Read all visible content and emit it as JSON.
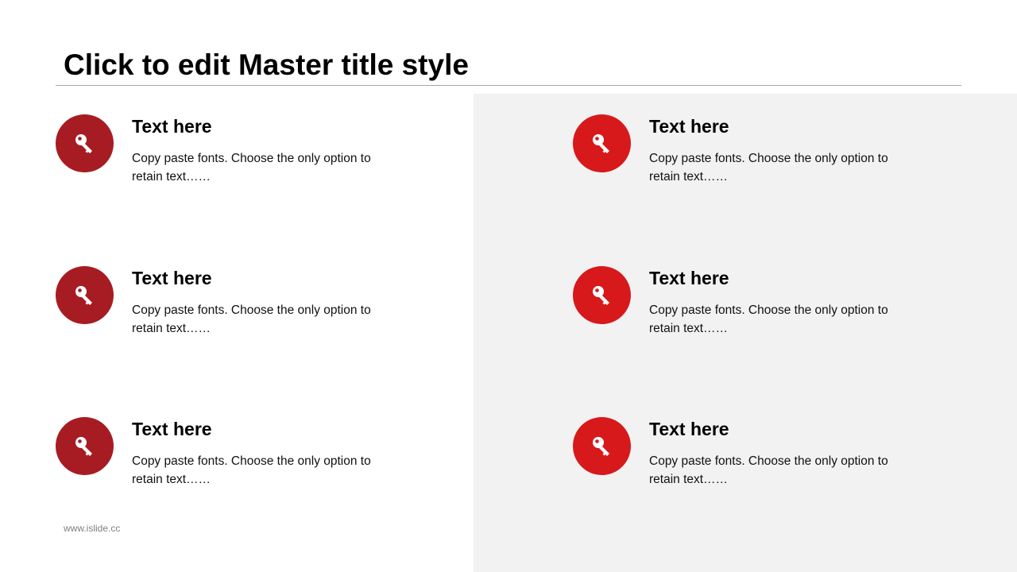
{
  "slide": {
    "title": "Click to edit Master title style",
    "footer": "www.islide.cc"
  },
  "colors": {
    "icon_left": "#a71c22",
    "icon_right": "#d7191c",
    "panel_background": "#f2f2f2",
    "divider": "#a6a6a6"
  },
  "items": [
    {
      "icon": "key-icon",
      "heading": "Text here",
      "description": "Copy paste fonts. Choose the only option to retain text……"
    },
    {
      "icon": "key-icon",
      "heading": "Text here",
      "description": "Copy paste fonts. Choose the only option to retain text……"
    },
    {
      "icon": "key-icon",
      "heading": "Text here",
      "description": "Copy paste fonts. Choose the only option to retain text……"
    },
    {
      "icon": "key-icon",
      "heading": "Text here",
      "description": "Copy paste fonts. Choose the only option to retain text……"
    },
    {
      "icon": "key-icon",
      "heading": "Text here",
      "description": "Copy paste fonts. Choose the only option to retain text……"
    },
    {
      "icon": "key-icon",
      "heading": "Text here",
      "description": "Copy paste fonts. Choose the only option to retain text……"
    }
  ]
}
